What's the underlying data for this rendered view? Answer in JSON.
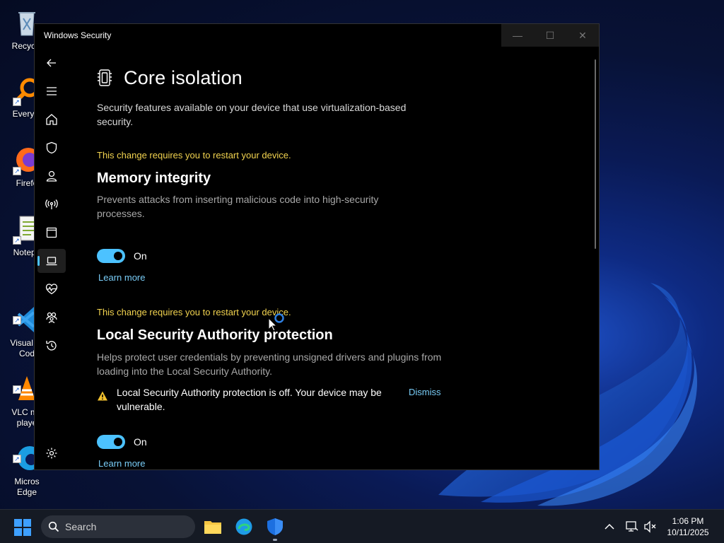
{
  "desktop": {
    "icons": [
      {
        "label": "Recycle",
        "icon": "recycle-bin-icon"
      },
      {
        "label": "Everyth",
        "icon": "everything-search-icon"
      },
      {
        "label": "Firefo",
        "icon": "firefox-icon"
      },
      {
        "label": "Notepa",
        "icon": "notepad-icon"
      },
      {
        "label": "Visual St\nCod",
        "icon": "vscode-icon"
      },
      {
        "label": "VLC me\nplaye",
        "icon": "vlc-icon"
      },
      {
        "label": "Micros\nEdge",
        "icon": "edge-icon"
      }
    ]
  },
  "window": {
    "title": "Windows Security",
    "controls": {
      "minimize": "—",
      "maximize": "☐",
      "close": "✕"
    }
  },
  "nav": {
    "items": [
      {
        "name": "back",
        "icon": "back-arrow-icon"
      },
      {
        "name": "menu",
        "icon": "hamburger-icon"
      },
      {
        "name": "home",
        "icon": "home-icon"
      },
      {
        "name": "virus-protection",
        "icon": "shield-icon"
      },
      {
        "name": "account-protection",
        "icon": "person-icon"
      },
      {
        "name": "firewall",
        "icon": "antenna-icon"
      },
      {
        "name": "app-browser-control",
        "icon": "app-window-icon"
      },
      {
        "name": "device-security",
        "icon": "laptop-icon",
        "active": true
      },
      {
        "name": "device-performance",
        "icon": "heart-pulse-icon"
      },
      {
        "name": "family-options",
        "icon": "family-icon"
      },
      {
        "name": "protection-history",
        "icon": "history-icon"
      },
      {
        "name": "settings",
        "icon": "gear-icon"
      }
    ]
  },
  "page": {
    "title": "Core isolation",
    "description": "Security features available on your device that use virtualization-based security.",
    "memory_integrity": {
      "restart_notice": "This change requires you to restart your device.",
      "title": "Memory integrity",
      "description": "Prevents attacks from inserting malicious code into high-security processes.",
      "toggle_label": "On",
      "toggle_on": true,
      "learn_more": "Learn more"
    },
    "lsa": {
      "restart_notice": "This change requires you to restart your device.",
      "title": "Local Security Authority protection",
      "description": "Helps protect user credentials by preventing unsigned drivers and plugins from loading into the Local Security Authority.",
      "alert_text": "Local Security Authority protection is off. Your device may be vulnerable.",
      "dismiss": "Dismiss",
      "toggle_label": "On",
      "toggle_on": true,
      "learn_more": "Learn more"
    }
  },
  "taskbar": {
    "search_placeholder": "Search",
    "apps": [
      "file-explorer-icon",
      "edge-icon",
      "windows-security-icon"
    ],
    "time": "1:06 PM",
    "date": "10/11/2025"
  },
  "colors": {
    "accent": "#4cc2ff",
    "link": "#79cdf8",
    "warning": "#f2d34f"
  }
}
